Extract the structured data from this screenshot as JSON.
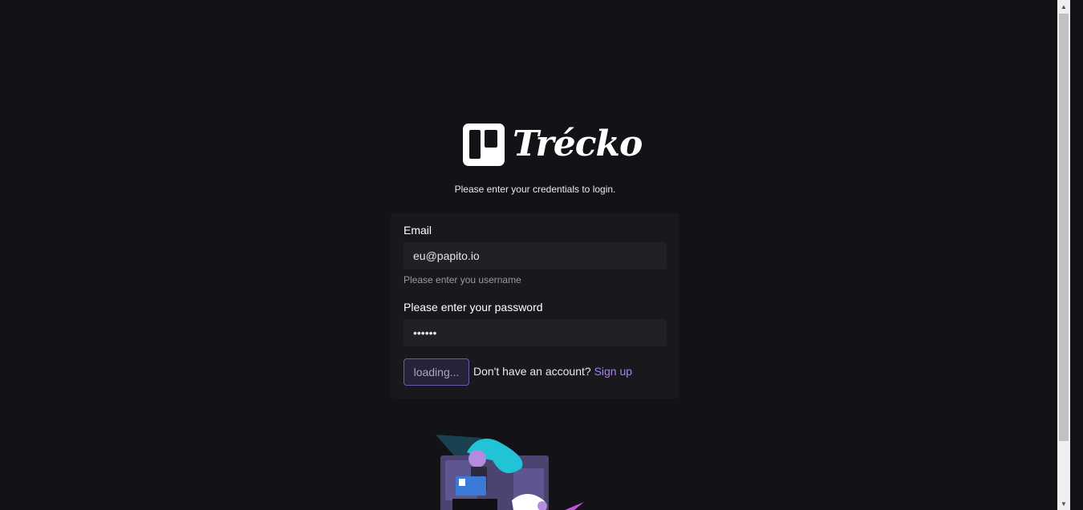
{
  "brand": {
    "name": "Trécko",
    "logo_icon": "trello-board-icon"
  },
  "subtitle": "Please enter your credentials to login.",
  "form": {
    "email_label": "Email",
    "email_value": "eu@papito.io",
    "email_helper": "Please enter you username",
    "password_label": "Please enter your password",
    "password_value": "••••••",
    "submit_label": "loading...",
    "signup_prompt": "Don't have an account?",
    "signup_link": "Sign up"
  },
  "colors": {
    "background": "#131317",
    "card": "#18181d",
    "input": "#202127",
    "accent": "#a783f5",
    "button_border": "#6c5aa6"
  }
}
